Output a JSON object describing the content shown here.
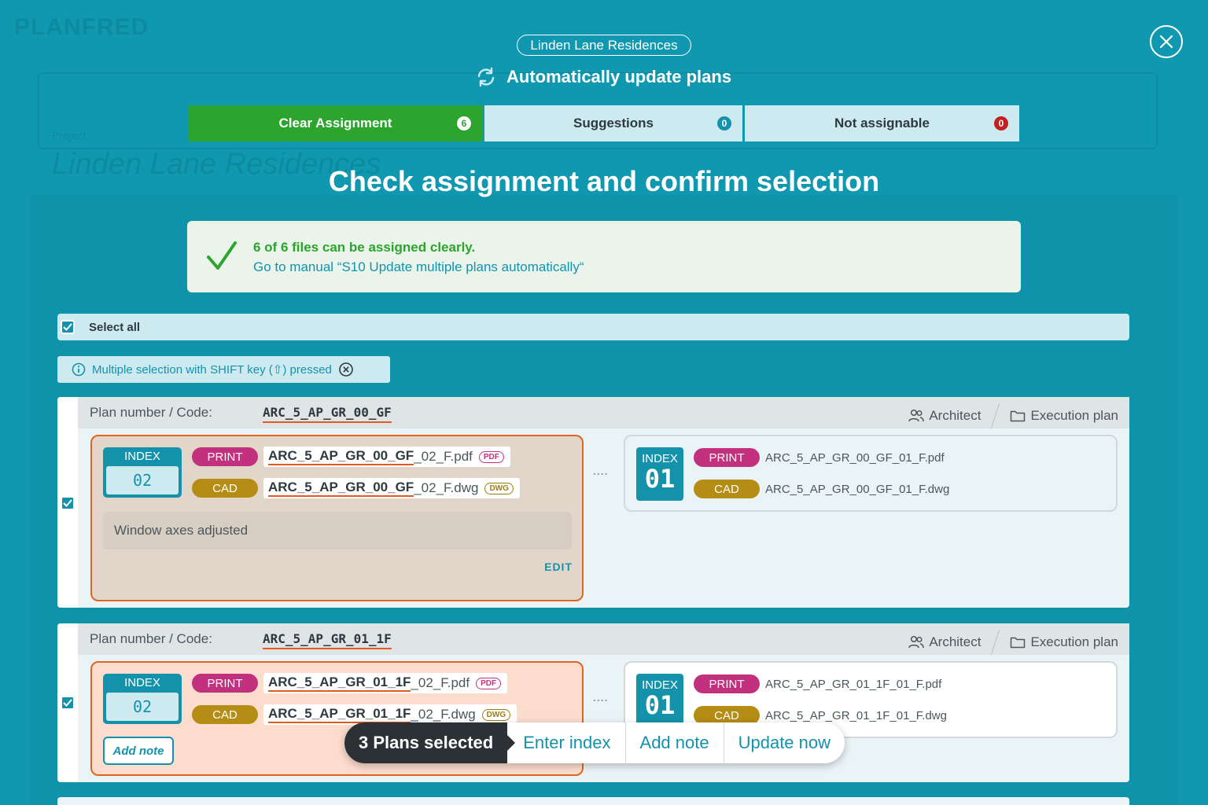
{
  "background": {
    "logo": "PLANFRED",
    "project_label": "Project",
    "project_title": "Linden Lane Residences"
  },
  "modal": {
    "project_pill": "Linden Lane Residences",
    "auto_update_label": "Automatically update plans",
    "tabs": [
      {
        "label": "Clear Assignment",
        "count": "6"
      },
      {
        "label": "Suggestions",
        "count": "0"
      },
      {
        "label": "Not assignable",
        "count": "0"
      }
    ],
    "heading": "Check assignment and confirm selection",
    "success": {
      "line1": "6 of 6 files can be assigned clearly.",
      "line2": "Go to manual “S10 Update multiple plans automatically“"
    },
    "select_all": "Select all",
    "hint": "Multiple selection with SHIFT key (⇧) pressed"
  },
  "plans": [
    {
      "label": "Plan number / Code:",
      "code": "ARC_5_AP_GR_00_GF",
      "architect": "Architect",
      "plan_type": "Execution plan",
      "new_index_label": "INDEX",
      "new_index": "02",
      "print_tag": "PRINT",
      "cad_tag": "CAD",
      "new_print_base": "ARC_5_AP_GR_00_GF",
      "new_print_rest": "_02_F.pdf",
      "new_cad_base": "ARC_5_AP_GR_00_GF",
      "new_cad_rest": "_02_F.dwg",
      "pdf_ext": "PDF",
      "dwg_ext": "DWG",
      "note": "Window axes adjusted",
      "edit": "EDIT",
      "old_index_label": "INDEX",
      "old_index": "01",
      "old_print": "ARC_5_AP_GR_00_GF_01_F.pdf",
      "old_cad": "ARC_5_AP_GR_00_GF_01_F.dwg",
      "dots": "....",
      "status": "update"
    },
    {
      "label": "Plan number / Code:",
      "code": "ARC_5_AP_GR_01_1F",
      "architect": "Architect",
      "plan_type": "Execution plan",
      "new_index_label": "INDEX",
      "new_index": "02",
      "print_tag": "PRINT",
      "cad_tag": "CAD",
      "new_print_base": "ARC_5_AP_GR_01_1F",
      "new_print_rest": "_02_F.pdf",
      "new_cad_base": "ARC_5_AP_GR_01_1F",
      "new_cad_rest": "_02_F.dwg",
      "pdf_ext": "PDF",
      "dwg_ext": "DWG",
      "add_note": "Add note",
      "old_index_label": "INDEX",
      "old_index": "01",
      "old_print": "ARC_5_AP_GR_01_1F_01_F.pdf",
      "old_cad": "ARC_5_AP_GR_01_1F_01_F.dwg",
      "dots": "....",
      "status": "new"
    }
  ],
  "action_bar": {
    "selected": "3 Plans selected",
    "enter_index": "Enter index",
    "add_note": "Add note",
    "update_now": "Update now"
  },
  "colors": {
    "backdrop": "#0f98b0",
    "primary": "#1592ab",
    "success": "#2ca42d",
    "danger": "#c41e1e",
    "highlight": "#e25b1e",
    "print": "#c2317d",
    "cad": "#b58c14"
  },
  "icons": [
    "close-icon",
    "refresh-icon",
    "check-icon",
    "info-icon",
    "circle-x-icon",
    "users-icon",
    "folder-icon",
    "checkbox-icon"
  ]
}
